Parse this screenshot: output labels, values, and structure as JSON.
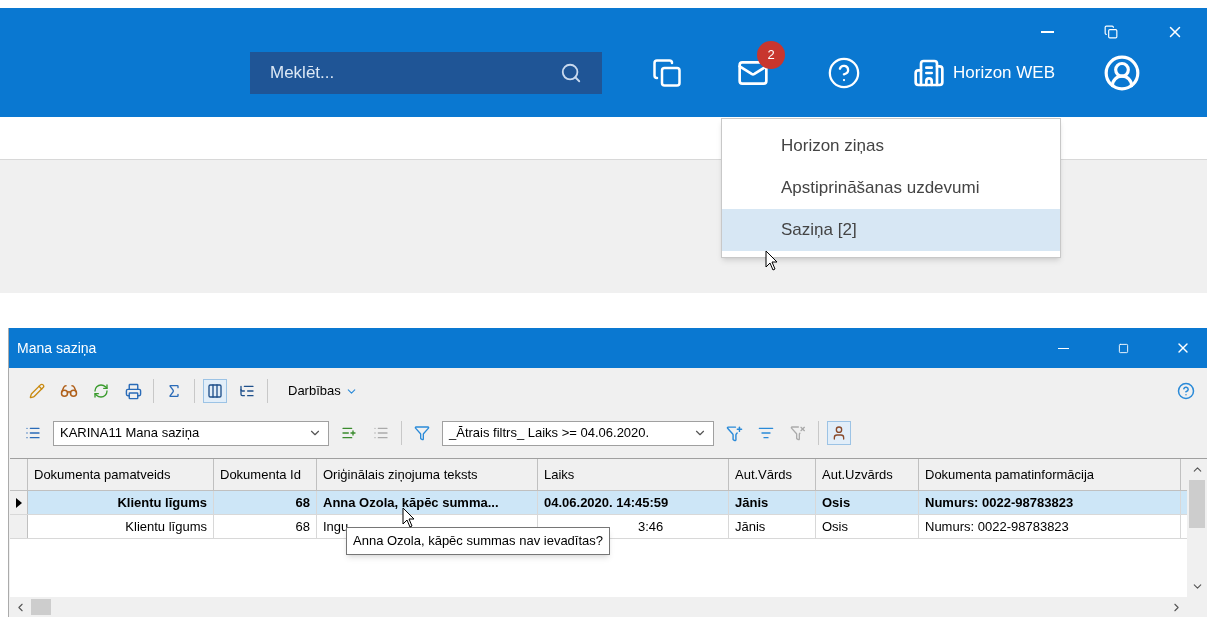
{
  "header": {
    "search": {
      "placeholder": "Meklēt..."
    },
    "mail_badge": "2",
    "company": "Horizon WEB"
  },
  "menu": {
    "items": [
      {
        "label": "Horizon ziņas",
        "selected": false
      },
      {
        "label": "Apstiprināšanas uzdevumi",
        "selected": false
      },
      {
        "label": "Saziņa [2]",
        "selected": true
      }
    ]
  },
  "window": {
    "title": "Mana saziņa"
  },
  "toolbar": {
    "actions_label": "Darbības",
    "layout": "KARINA11 Mana saziņa",
    "filter": "_Ātrais filtrs_ Laiks >= 04.06.2020."
  },
  "table": {
    "columns": [
      "Dokumenta pamatveids",
      "Dokumenta Id",
      "Oriģinālais ziņojuma teksts",
      "Laiks",
      "Aut.Vārds",
      "Aut.Uzvārds",
      "Dokumenta pamatinformācija"
    ],
    "rows": [
      {
        "selected": true,
        "covered": false,
        "cells": [
          "Klientu līgums",
          "68",
          "Anna Ozola, kāpēc summa...",
          "04.06.2020. 14:45:59",
          "Jānis",
          "Osis",
          "Numurs: 0022-98783823"
        ]
      },
      {
        "selected": false,
        "covered": true,
        "cells": [
          "Klientu līgums",
          "68",
          "Ingu",
          "3:46",
          "Jānis",
          "Osis",
          "Numurs: 0022-98783823"
        ]
      }
    ]
  },
  "tooltip": "Anna Ozola, kāpēc summas nav ievadītas?"
}
